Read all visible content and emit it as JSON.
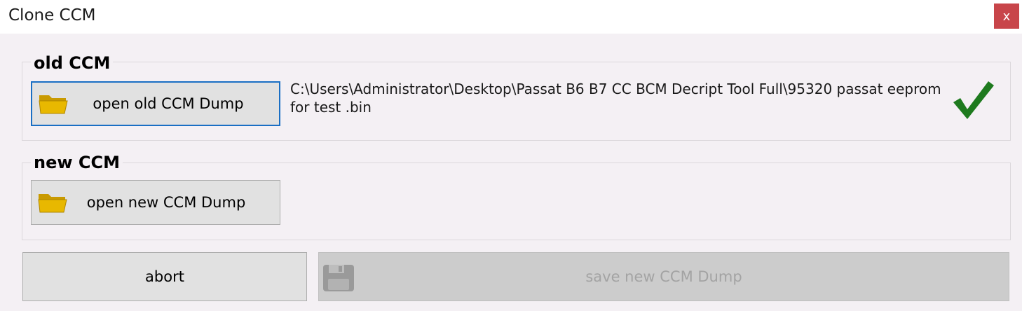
{
  "window": {
    "title": "Clone CCM",
    "close_glyph": "x",
    "close_icon": "close-icon"
  },
  "old_group": {
    "label": "old CCM",
    "button_label": "open old CCM Dump",
    "button_icon": "folder-icon",
    "path_text": "C:\\Users\\Administrator\\Desktop\\Passat B6 B7 CC BCM Decript Tool Full\\95320 passat eeprom for test .bin",
    "status_icon": "checkmark-icon",
    "status_color": "#1e7a1e"
  },
  "new_group": {
    "label": "new CCM",
    "button_label": "open new CCM Dump",
    "button_icon": "folder-icon"
  },
  "footer": {
    "abort_label": "abort",
    "save_label": "save new CCM Dump",
    "save_icon": "floppy-disk-icon",
    "save_enabled": false
  },
  "colors": {
    "focus_border": "#1a6fc4",
    "close_bg": "#c8454a",
    "folder": "#e0b000"
  }
}
